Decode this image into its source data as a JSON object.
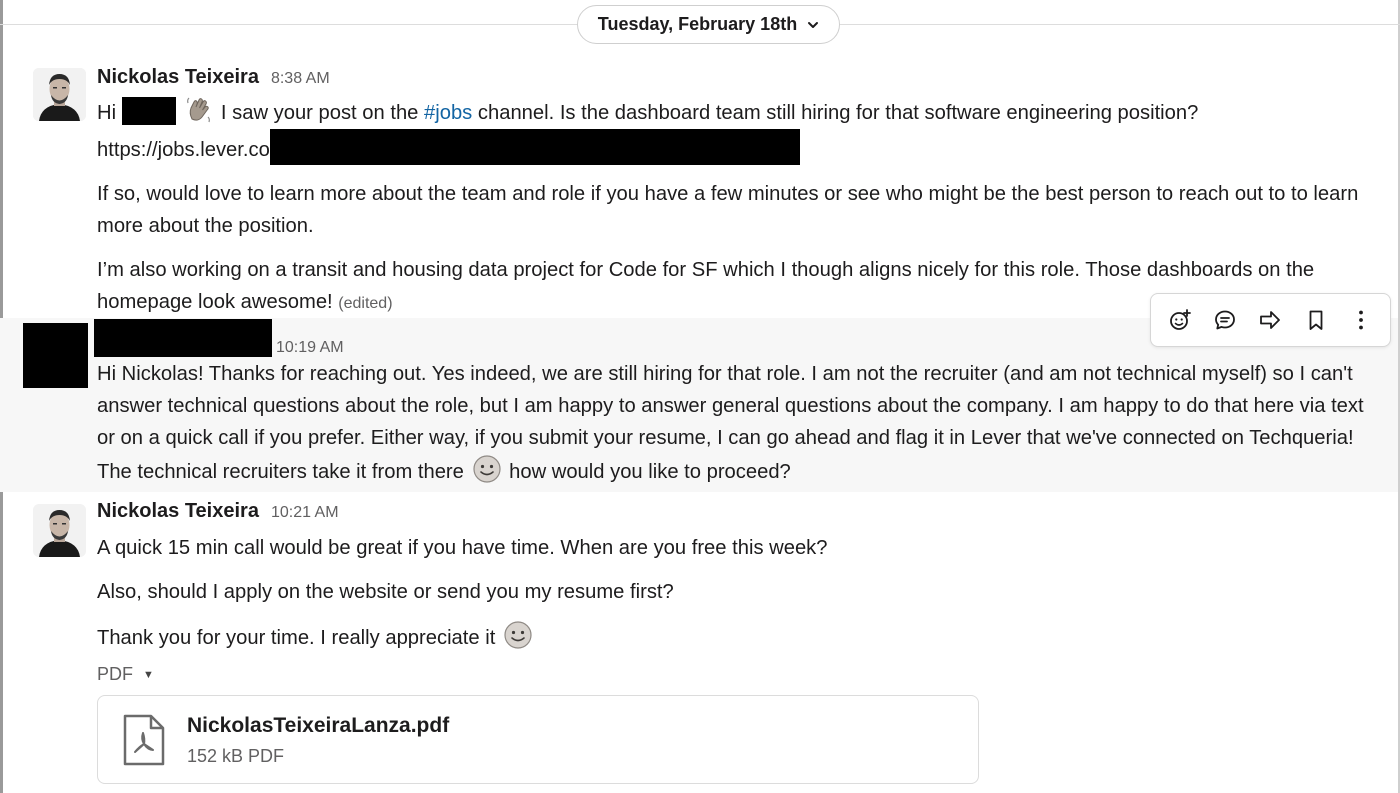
{
  "date_divider": {
    "label": "Tuesday, February 18th"
  },
  "messages": [
    {
      "author": "Nickolas Teixeira",
      "time": "8:38 AM",
      "greeting": "Hi",
      "line1_rest": "I saw your post on the",
      "channel": "#jobs",
      "line1_tail": "channel. Is the dashboard team still hiring for that software engineering position?",
      "link": "https://jobs.lever.co",
      "para2": "If so, would love to learn more about the team and role if you have a few minutes or see who might be the best person to reach out to to learn more about the position.",
      "para3": "I’m also working on a transit and housing data project for Code for SF which I though aligns nicely for this role. Those dashboards on the homepage look awesome!",
      "edited": "(edited)"
    },
    {
      "time": "10:19 AM",
      "text_a": "Hi Nickolas! Thanks for reaching out. Yes indeed, we are still hiring for that role. I am not the recruiter (and am not technical myself) so I can't answer technical questions about the role, but I am happy to answer general questions about the company. I am happy to do that here via text or on a quick call if you prefer. Either way, if you submit your resume, I can go ahead and flag it in Lever that we've connected on Techqueria! The technical recruiters take it from there",
      "text_b": "how would you like to proceed?"
    },
    {
      "author": "Nickolas Teixeira",
      "time": "10:21 AM",
      "para1": "A quick 15 min call would be great if you have time. When are you free this week?",
      "para2": "Also, should I apply on the website or send you my resume first?",
      "para3": "Thank you for your time. I really appreciate it",
      "file_type": "PDF",
      "file": {
        "name": "NickolasTeixeiraLanza.pdf",
        "meta": "152 kB PDF"
      }
    }
  ],
  "toolbar_icons": [
    "add-reaction-icon",
    "reply-in-thread-icon",
    "share-icon",
    "save-bookmark-icon",
    "more-actions-icon"
  ],
  "colors": {
    "link_blue": "#1264a3",
    "text": "#1d1c1d",
    "muted": "#616061",
    "hover_bg": "#f7f7f7"
  }
}
